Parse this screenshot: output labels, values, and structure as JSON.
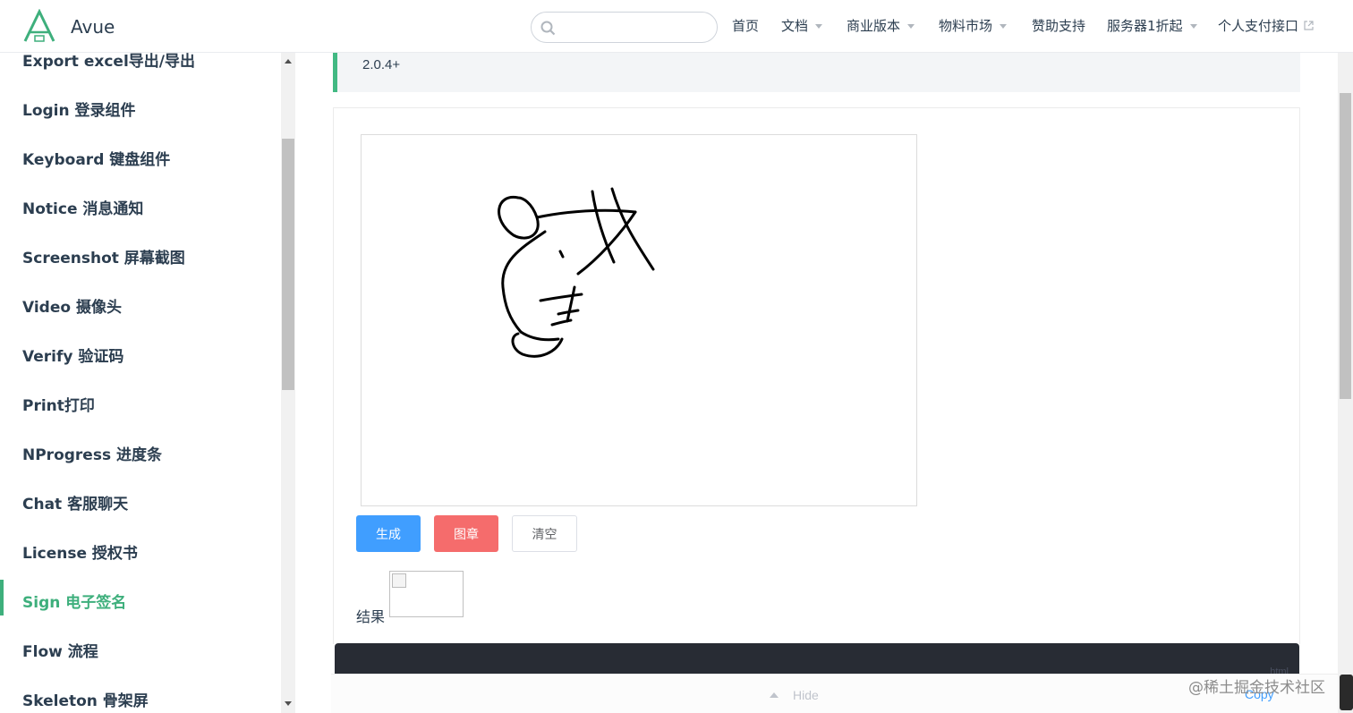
{
  "header": {
    "brand": "Avue",
    "search": {
      "value": "",
      "placeholder": ""
    },
    "nav": [
      {
        "label": "首页",
        "dropdown": false
      },
      {
        "label": "文档",
        "dropdown": true
      },
      {
        "label": "商业版本",
        "dropdown": true
      },
      {
        "label": "物料市场",
        "dropdown": true
      },
      {
        "label": "赞助支持",
        "dropdown": false
      },
      {
        "label": "服务器1折起",
        "dropdown": true
      },
      {
        "label": "个人支付接口",
        "dropdown": false,
        "external": true
      }
    ]
  },
  "sidebar": {
    "items": [
      {
        "label": "Export excel导出/导出",
        "active": false
      },
      {
        "label": "Login 登录组件",
        "active": false
      },
      {
        "label": "Keyboard 键盘组件",
        "active": false
      },
      {
        "label": "Notice 消息通知",
        "active": false
      },
      {
        "label": "Screenshot 屏幕截图",
        "active": false
      },
      {
        "label": "Video 摄像头",
        "active": false
      },
      {
        "label": "Verify 验证码",
        "active": false
      },
      {
        "label": "Print打印",
        "active": false
      },
      {
        "label": "NProgress 进度条",
        "active": false
      },
      {
        "label": "Chat 客服聊天",
        "active": false
      },
      {
        "label": "License 授权书",
        "active": false
      },
      {
        "label": "Sign 电子签名",
        "active": true
      },
      {
        "label": "Flow 流程",
        "active": false
      },
      {
        "label": "Skeleton 骨架屏",
        "active": false
      }
    ]
  },
  "content": {
    "version_tip": "2.0.4+",
    "buttons": {
      "generate": "生成",
      "seal": "图章",
      "clear": "清空"
    },
    "result_label": "结果",
    "code_lang": "html",
    "hide_label": "Hide",
    "copy_label": "Copy"
  },
  "watermark": "@稀土掘金技术社区",
  "colors": {
    "accent": "#3eaf7c",
    "primary": "#409eff",
    "danger": "#f56c6c",
    "code_bg": "#282c34"
  }
}
